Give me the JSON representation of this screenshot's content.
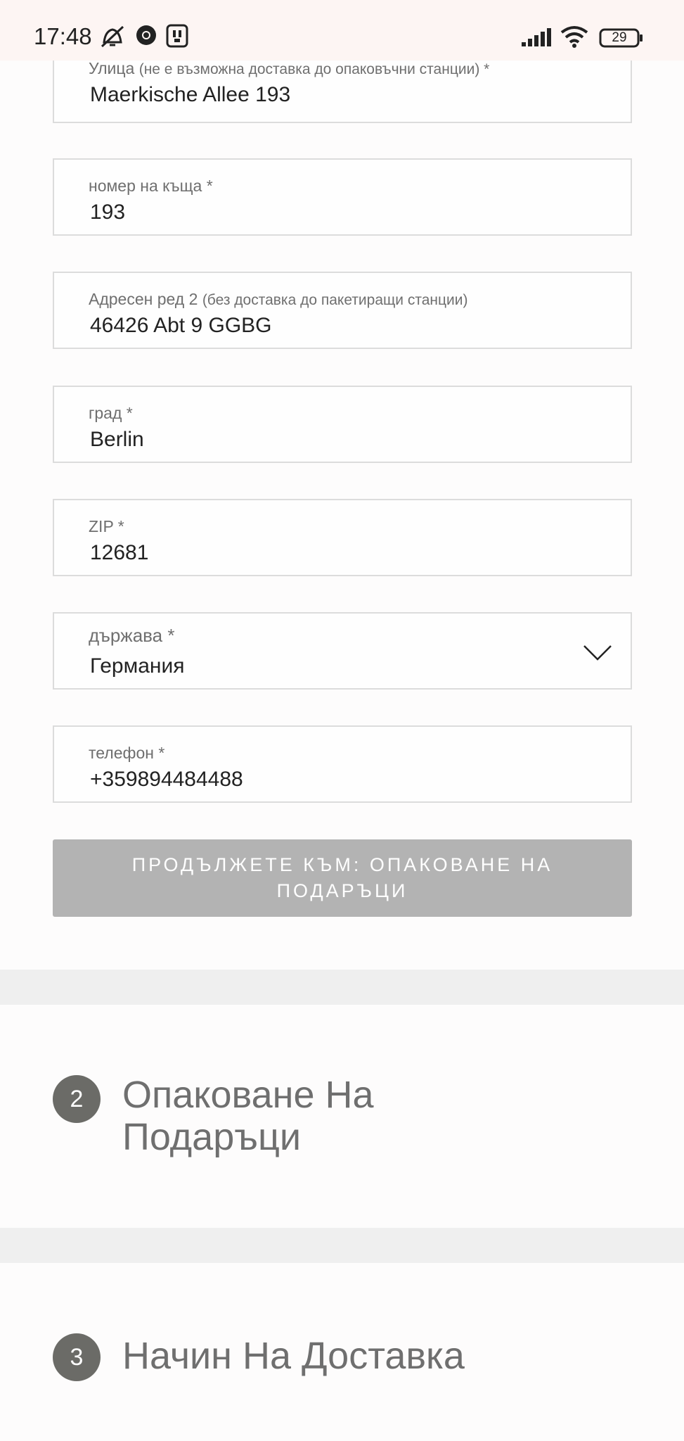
{
  "status_bar": {
    "time": "17:48",
    "battery": "29",
    "icons": [
      "alarm-off-icon",
      "chrome-icon",
      "app-icon",
      "signal-icon",
      "wifi-icon",
      "battery-icon"
    ]
  },
  "form": {
    "street": {
      "label": "Улица",
      "hint": "(не е възможна доставка до опаковъчни станции) *",
      "value": "Maerkische Allee 193"
    },
    "house_number": {
      "label": "номер на къща *",
      "value": "193"
    },
    "address_line2": {
      "label": "Адресен ред 2",
      "hint": "(без доставка до пакетиращи станции)",
      "value": "46426 Abt 9 GGBG"
    },
    "city": {
      "label": "град *",
      "value": "Berlin"
    },
    "zip": {
      "label": "ZIP *",
      "value": "12681"
    },
    "country": {
      "label": "държава *",
      "value": "Германия"
    },
    "phone": {
      "label": "телефон *",
      "value": "+359894484488"
    }
  },
  "continue_button": {
    "label": "ПРОДЪЛЖЕТЕ КЪМ: ОПАКОВАНЕ НА ПОДАРЪЦИ"
  },
  "steps": [
    {
      "number": "2",
      "title_line1": "Опаковане На",
      "title_line2": "Подаръци"
    },
    {
      "number": "3",
      "title_line1": "Начин На Доставка"
    }
  ],
  "colors": {
    "button_disabled": "#b3b3b3",
    "step_badge": "#6b6b67",
    "section_band": "#efefef"
  }
}
